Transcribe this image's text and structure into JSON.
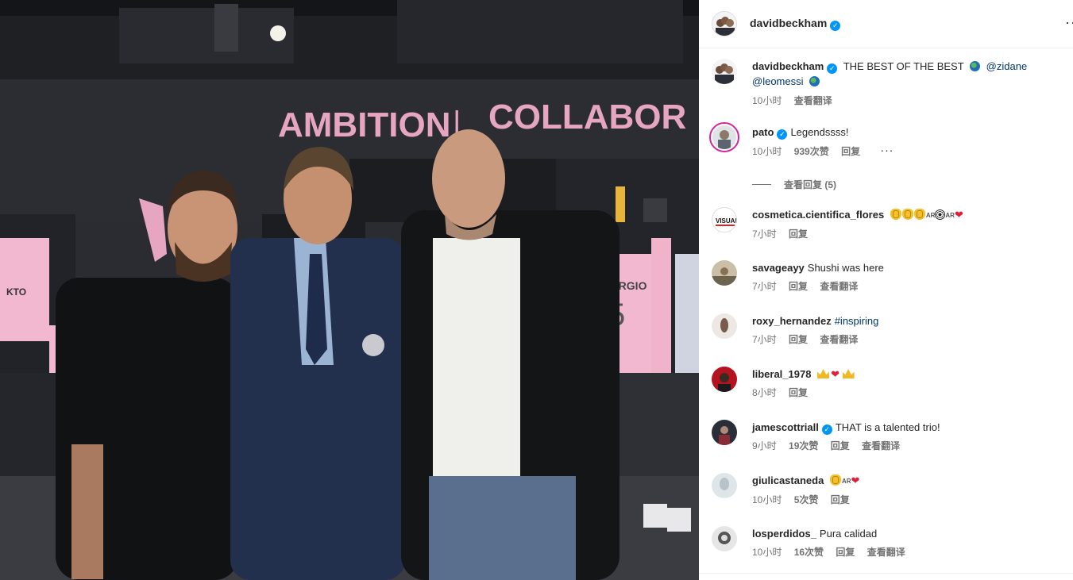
{
  "photo": {
    "sign_left": "AMBITION",
    "sign_sep": "|",
    "sign_right": "COLLABOR",
    "jersey_text": "SERGIO",
    "jersey_number": "5",
    "jersey_small": "KTO",
    "box_text": "VISUAL"
  },
  "header": {
    "username": "davidbeckham",
    "more": "···"
  },
  "caption": {
    "username": "davidbeckham",
    "text": "THE BEST OF THE BEST",
    "mention1": "@zidane",
    "mention2": "@leomessi",
    "time": "10小时",
    "translate": "查看翻译"
  },
  "comments": [
    {
      "username": "pato",
      "verified": true,
      "text": "Legendssss!",
      "time": "10小时",
      "likes": "939次赞",
      "reply": "回复",
      "more": "···"
    },
    {
      "username": "cosmetica.cientifica_flores",
      "text": "",
      "time": "7小时",
      "reply": "回复"
    },
    {
      "username": "savageayy",
      "text": "Shushi was here",
      "time": "7小时",
      "reply": "回复",
      "translate": "查看翻译"
    },
    {
      "username": "roxy_hernandez",
      "text": "#inspiring",
      "time": "7小时",
      "reply": "回复",
      "translate": "查看翻译"
    },
    {
      "username": "liberal_1978",
      "text": "",
      "time": "8小时",
      "reply": "回复"
    },
    {
      "username": "jamescottriall",
      "verified": true,
      "text": "THAT is a talented trio!",
      "time": "9小时",
      "likes": "19次赞",
      "reply": "回复",
      "translate": "查看翻译"
    },
    {
      "username": "giulicastaneda",
      "text": "",
      "time": "10小时",
      "likes": "5次赞",
      "reply": "回复"
    },
    {
      "username": "losperdidos_",
      "text": "Pura calidad",
      "time": "10小时",
      "likes": "16次赞",
      "reply": "回复",
      "translate": "查看翻译"
    }
  ],
  "view_replies": "查看回复 (5)",
  "emoji": {
    "ar": "AR"
  },
  "colors": {
    "accent_link": "#00376b",
    "verified": "#0095f6",
    "muted": "#737373",
    "sign_pink": "#e8a6c4"
  }
}
